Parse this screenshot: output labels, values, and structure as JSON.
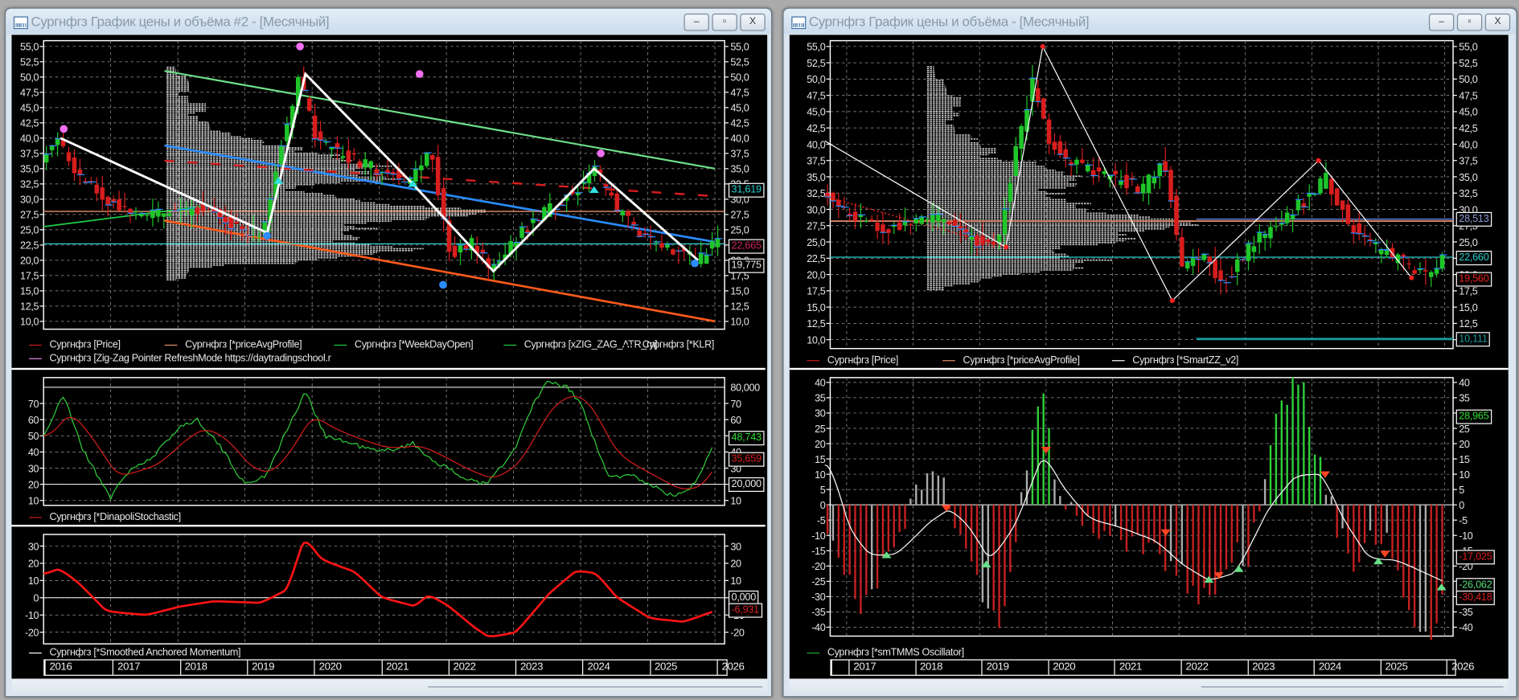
{
  "left_window": {
    "title": "Сургнфгз График цены и объёма #2 - [Месячный]",
    "buttons": {
      "minimize": "–",
      "maximize": "▫",
      "close": "X"
    },
    "price_legend": [
      {
        "label": "Сургнфгз [Price]",
        "color": "#c41e1e"
      },
      {
        "label": "Сургнфгз [*priceAvgProfile]",
        "color": "#e8906a"
      },
      {
        "label": "Сургнфгз [*WeekDayOpen]",
        "color": "#22cc44"
      },
      {
        "label": "Сургнфгз [xZIG_ZAG_ATR_m]",
        "color": "#22cc44"
      },
      {
        "label": "Сургнфгз [*KLR]",
        "color": "#000000"
      },
      {
        "label": "Сургнфгз [Zig-Zag Pointer RefreshMode https://daytradingschool.r",
        "color": "#e58ae5"
      }
    ],
    "stoch_legend": {
      "label": "Сургнфгз [*DinapoliStochastic]",
      "color": "#c41e1e"
    },
    "mom_legend": {
      "label": "Сургнфгз [*Smoothed Anchored Momentum]",
      "color": "#ffffff"
    },
    "years": [
      "2016",
      "2017",
      "2018",
      "2019",
      "2020",
      "2021",
      "2022",
      "2023",
      "2024",
      "2025",
      "2026"
    ],
    "price_tags": [
      {
        "text": "31,619",
        "value": 31.6,
        "color": "#2ad0d0"
      },
      {
        "text": "22,665",
        "value": 22.3,
        "color": "#d0245a"
      },
      {
        "text": "19,775",
        "value": 19.2,
        "color": "#e8e8e8"
      }
    ],
    "stoch_tags": [
      {
        "text": "48,743",
        "value": 48.7,
        "color": "#33dd33"
      },
      {
        "text": "35,659",
        "value": 35.7,
        "color": "#dd2222"
      },
      {
        "text": "20,000",
        "value": 20,
        "color": "#e8e8e8"
      }
    ],
    "mom_tags": [
      {
        "text": "0,000",
        "value": 0,
        "color": "#e8e8e8"
      },
      {
        "text": "-6,931",
        "value": -6.9,
        "color": "#dd2222"
      }
    ],
    "stoch_top_label": "80,000"
  },
  "right_window": {
    "title": "Сургнфгз График цены и объёма - [Месячный]",
    "buttons": {
      "minimize": "–",
      "maximize": "▫",
      "close": "X"
    },
    "price_legend": [
      {
        "label": "Сургнфгз [Price]",
        "color": "#c41e1e"
      },
      {
        "label": "Сургнфгз [*priceAvgProfile]",
        "color": "#e8906a"
      },
      {
        "label": "Сургнфгз [*SmartZZ_v2]",
        "color": "#ffffff"
      }
    ],
    "osc_legend": {
      "label": "Сургнфгз [*smTMMS Oscillator]",
      "color": "#22aa33"
    },
    "years": [
      "2017",
      "2018",
      "2019",
      "2020",
      "2021",
      "2022",
      "2023",
      "2024",
      "2025",
      "2026"
    ],
    "price_tags": [
      {
        "text": "28,513",
        "value": 28.5,
        "color": "#8f9fd8"
      },
      {
        "text": "22,660",
        "value": 22.66,
        "color": "#2ad0d0"
      },
      {
        "text": "19,560",
        "value": 19.4,
        "color": "#ee2222"
      },
      {
        "text": "10,111",
        "value": 10.1,
        "color": "#1a9a9a"
      }
    ],
    "osc_tags": [
      {
        "text": "28,965",
        "value": 29,
        "color": "#33dd33"
      },
      {
        "text": "-17,025",
        "value": -17,
        "color": "#dd2222"
      },
      {
        "text": "-26,062",
        "value": -26,
        "color": "#55dd77"
      },
      {
        "text": "-30,418",
        "value": -30.4,
        "color": "#dd2222"
      }
    ]
  },
  "chart_data": {
    "type": "candlestick",
    "instrument": "Сургнфгз",
    "timeframe": "Месячный",
    "price_ylim": [
      10,
      55
    ],
    "price_path": [
      [
        2016.0,
        36
      ],
      [
        2016.25,
        40
      ],
      [
        2016.6,
        33
      ],
      [
        2017.0,
        30
      ],
      [
        2017.5,
        27
      ],
      [
        2018.0,
        28
      ],
      [
        2018.5,
        28.5
      ],
      [
        2019.0,
        25
      ],
      [
        2019.3,
        24.5
      ],
      [
        2019.6,
        40
      ],
      [
        2019.85,
        50
      ],
      [
        2020.1,
        40
      ],
      [
        2020.5,
        37
      ],
      [
        2021.0,
        35
      ],
      [
        2021.5,
        33
      ],
      [
        2021.8,
        38
      ],
      [
        2022.1,
        21
      ],
      [
        2022.4,
        23
      ],
      [
        2022.7,
        18.5
      ],
      [
        2023.0,
        23
      ],
      [
        2023.5,
        28
      ],
      [
        2024.0,
        32
      ],
      [
        2024.25,
        35
      ],
      [
        2024.6,
        28
      ],
      [
        2025.0,
        24
      ],
      [
        2025.4,
        22
      ],
      [
        2025.8,
        20
      ],
      [
        2026.0,
        22.7
      ]
    ],
    "left_zigzag": [
      [
        2016.25,
        40
      ],
      [
        2019.33,
        24.5
      ],
      [
        2019.9,
        50.5
      ],
      [
        2021.5,
        32.5
      ],
      [
        2022.7,
        18.2
      ],
      [
        2024.2,
        35
      ],
      [
        2025.75,
        20
      ]
    ],
    "right_smartzz": [
      [
        2016.67,
        40.5
      ],
      [
        2019.4,
        24.2
      ],
      [
        2019.95,
        55
      ],
      [
        2021.9,
        16
      ],
      [
        2024.1,
        37.5
      ],
      [
        2025.5,
        19.5
      ]
    ],
    "left_lines": {
      "green_channel": [
        [
          2017.8,
          51
        ],
        [
          2026,
          35
        ]
      ],
      "blue_channel": [
        [
          2017.8,
          38.8
        ],
        [
          2026,
          23
        ]
      ],
      "orange_channel": [
        [
          2017.8,
          26.5
        ],
        [
          2026,
          10
        ]
      ],
      "avg_profile": 28.0,
      "week_open": 22.7
    },
    "right_lines": {
      "avg_profile": 28.2,
      "level_blue": 28.5,
      "level_cyan": 22.66,
      "level_teal": 10.1
    },
    "stochastic_fast": [
      [
        2016,
        50
      ],
      [
        2016.3,
        75
      ],
      [
        2016.6,
        40
      ],
      [
        2017,
        12
      ],
      [
        2017.3,
        30
      ],
      [
        2017.6,
        35
      ],
      [
        2018,
        55
      ],
      [
        2018.3,
        60
      ],
      [
        2018.6,
        45
      ],
      [
        2019,
        20
      ],
      [
        2019.3,
        25
      ],
      [
        2019.7,
        60
      ],
      [
        2019.9,
        77
      ],
      [
        2020.2,
        50
      ],
      [
        2020.6,
        45
      ],
      [
        2021,
        40
      ],
      [
        2021.5,
        45
      ],
      [
        2021.8,
        35
      ],
      [
        2022.2,
        25
      ],
      [
        2022.6,
        20
      ],
      [
        2023,
        40
      ],
      [
        2023.3,
        70
      ],
      [
        2023.5,
        83
      ],
      [
        2023.8,
        80
      ],
      [
        2024,
        70
      ],
      [
        2024.4,
        25
      ],
      [
        2024.8,
        25
      ],
      [
        2025.4,
        12
      ],
      [
        2025.7,
        20
      ],
      [
        2026,
        48
      ]
    ],
    "momentum": [
      [
        2016,
        14
      ],
      [
        2016.2,
        17
      ],
      [
        2016.5,
        8
      ],
      [
        2016.9,
        -8
      ],
      [
        2017.5,
        -10
      ],
      [
        2018,
        -5
      ],
      [
        2018.5,
        -2
      ],
      [
        2019.2,
        -3
      ],
      [
        2019.6,
        5
      ],
      [
        2019.85,
        36
      ],
      [
        2020.1,
        22
      ],
      [
        2020.6,
        15
      ],
      [
        2021,
        0
      ],
      [
        2021.5,
        -5
      ],
      [
        2021.7,
        2
      ],
      [
        2022,
        -5
      ],
      [
        2022.4,
        -18
      ],
      [
        2022.6,
        -23
      ],
      [
        2023,
        -20
      ],
      [
        2023.5,
        3
      ],
      [
        2023.9,
        16
      ],
      [
        2024.2,
        14
      ],
      [
        2024.5,
        0
      ],
      [
        2025,
        -12
      ],
      [
        2025.5,
        -14
      ],
      [
        2026,
        -7
      ]
    ],
    "tmms_histogram": [
      [
        2016.7,
        -10
      ],
      [
        2017,
        -25
      ],
      [
        2017.2,
        -35
      ],
      [
        2017.5,
        -20
      ],
      [
        2017.8,
        -10
      ],
      [
        2018,
        5
      ],
      [
        2018.4,
        10
      ],
      [
        2018.7,
        -15
      ],
      [
        2019,
        -30
      ],
      [
        2019.3,
        -40
      ],
      [
        2019.5,
        -15
      ],
      [
        2019.7,
        20
      ],
      [
        2019.9,
        35
      ],
      [
        2020.1,
        10
      ],
      [
        2020.4,
        -5
      ],
      [
        2020.8,
        -8
      ],
      [
        2021,
        -10
      ],
      [
        2021.5,
        -15
      ],
      [
        2021.9,
        -20
      ],
      [
        2022.2,
        -30
      ],
      [
        2022.5,
        -28
      ],
      [
        2022.8,
        -15
      ],
      [
        2023,
        -20
      ],
      [
        2023.2,
        5
      ],
      [
        2023.5,
        35
      ],
      [
        2023.8,
        40
      ],
      [
        2024,
        20
      ],
      [
        2024.3,
        -5
      ],
      [
        2024.6,
        -20
      ],
      [
        2024.9,
        -10
      ],
      [
        2025.2,
        -15
      ],
      [
        2025.5,
        -40
      ],
      [
        2025.8,
        -45
      ],
      [
        2026,
        -20
      ]
    ],
    "tmms_line": [
      [
        2016.7,
        13
      ],
      [
        2017,
        -10
      ],
      [
        2017.3,
        -17
      ],
      [
        2017.7,
        -16
      ],
      [
        2018.2,
        -5
      ],
      [
        2018.5,
        -1
      ],
      [
        2018.8,
        -8
      ],
      [
        2019.1,
        -19
      ],
      [
        2019.5,
        -5
      ],
      [
        2019.9,
        18
      ],
      [
        2020.2,
        5
      ],
      [
        2020.6,
        -5
      ],
      [
        2021,
        -7
      ],
      [
        2021.6,
        -12
      ],
      [
        2022,
        -20
      ],
      [
        2022.4,
        -25
      ],
      [
        2022.8,
        -22
      ],
      [
        2023.3,
        0
      ],
      [
        2023.7,
        10
      ],
      [
        2024.1,
        10
      ],
      [
        2024.4,
        -5
      ],
      [
        2024.8,
        -18
      ],
      [
        2025.2,
        -18
      ],
      [
        2025.6,
        -22
      ],
      [
        2026,
        -26
      ]
    ]
  }
}
